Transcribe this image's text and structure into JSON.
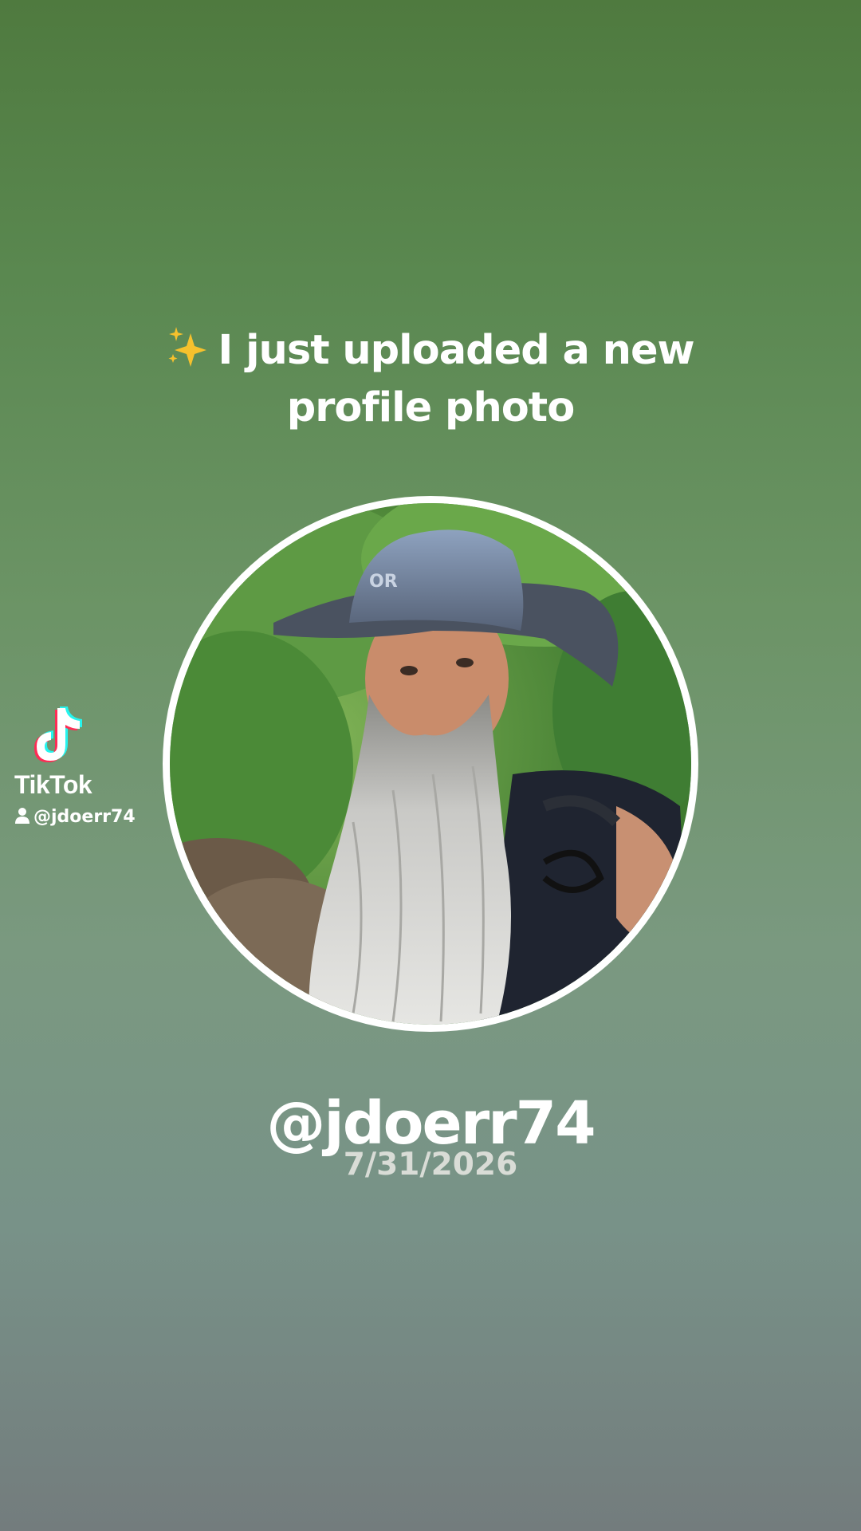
{
  "headline": {
    "emoji_icon": "sparkles-icon",
    "text": "I just uploaded a new profile photo"
  },
  "profile_photo": {
    "description_icon": "profile-photo"
  },
  "watermark": {
    "brand": "TikTok",
    "logo_icon": "tiktok-logo-icon",
    "user_icon": "person-icon",
    "username": "@jdoerr74"
  },
  "handle": "@jdoerr74",
  "date": "7/31/2026",
  "colors": {
    "background_top": "#4f7a3f",
    "background_bottom": "#737c7d",
    "text": "#ffffff",
    "date_text": "#d9dcd6",
    "frame": "#ffffff"
  }
}
